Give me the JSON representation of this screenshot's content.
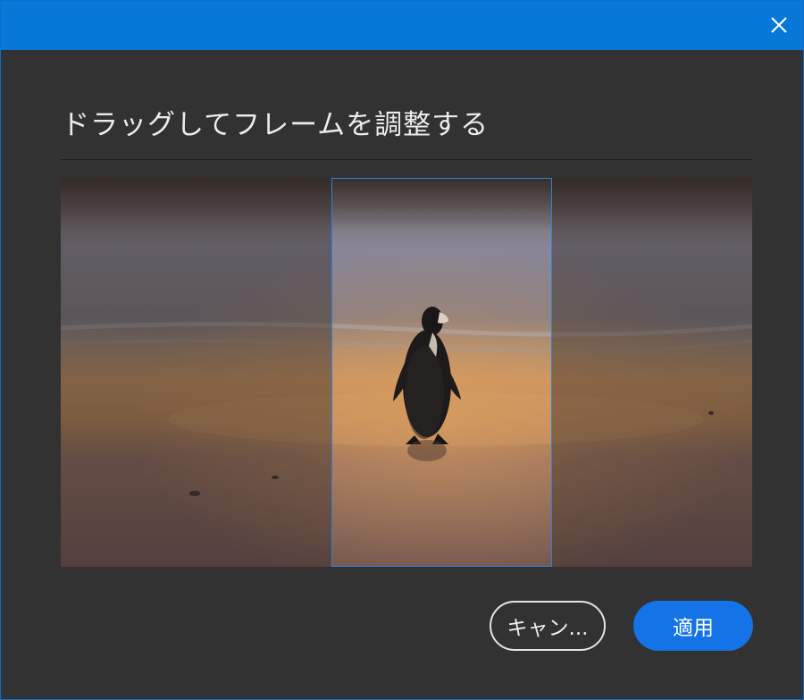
{
  "dialog": {
    "title": "ドラッグしてフレームを調整する",
    "close_icon": "close-icon",
    "cancel_label": "キャン...",
    "apply_label": "適用"
  },
  "preview": {
    "subject": "penguin-on-beach",
    "crop_frame": "crop-frame"
  },
  "colors": {
    "titlebar": "#0778d7",
    "background": "#323232",
    "accent": "#1473e6",
    "frame_border": "#2f7fe0"
  }
}
